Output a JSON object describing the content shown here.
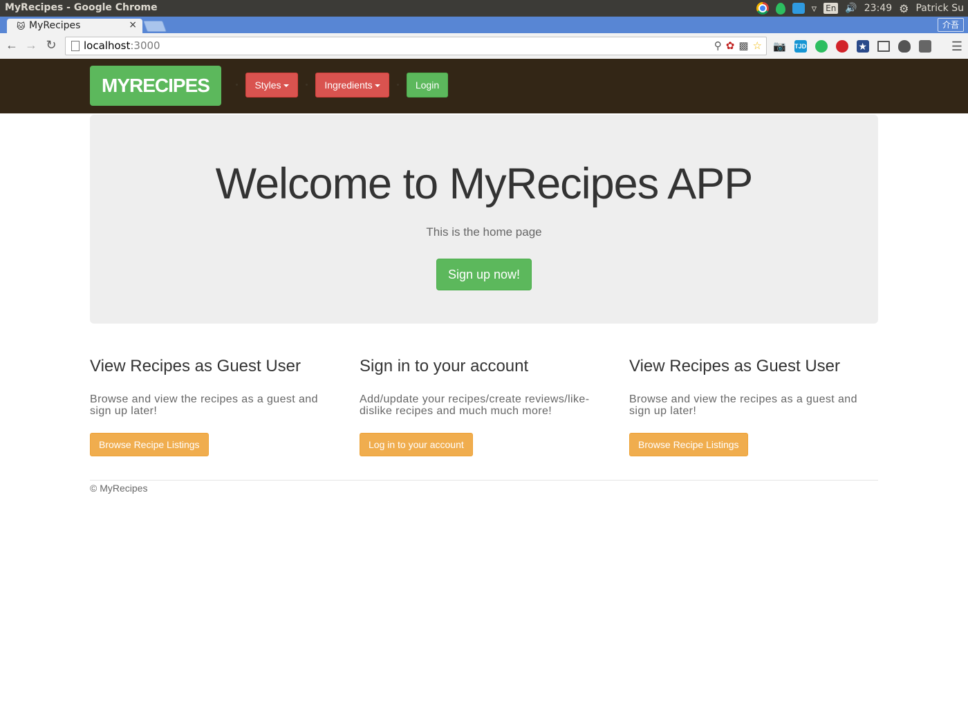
{
  "os": {
    "window_title": "MyRecipes - Google Chrome",
    "lang": "En",
    "clock": "23:49",
    "user": "Patrick Su"
  },
  "browser": {
    "tab_title": "MyRecipes",
    "tab_close": "×",
    "ime_label": "介吾",
    "url_host": "localhost",
    "url_port": ":3000"
  },
  "navbar": {
    "brand": "MYRECIPES",
    "styles_label": "Styles",
    "ingredients_label": "Ingredients",
    "login_label": "Login",
    "background": "#332616"
  },
  "hero": {
    "title": "Welcome to MyRecipes APP",
    "subtitle": "This is the home page",
    "signup_label": "Sign up now!"
  },
  "columns": [
    {
      "heading": "View Recipes as Guest User",
      "text": "Browse and view the recipes as a guest and sign up later!",
      "button": "Browse Recipe Listings"
    },
    {
      "heading": "Sign in to your account",
      "text": "Add/update your recipes/create reviews/like-dislike recipes and much much more!",
      "button": "Log in to your account"
    },
    {
      "heading": "View Recipes as Guest User",
      "text": "Browse and view the recipes as a guest and sign up later!",
      "button": "Browse Recipe Listings"
    }
  ],
  "footer": {
    "text": "© MyRecipes"
  },
  "colors": {
    "success": "#5cb85c",
    "danger": "#d9534f",
    "warning": "#f0ad4e",
    "jumbotron": "#eeeeee"
  }
}
